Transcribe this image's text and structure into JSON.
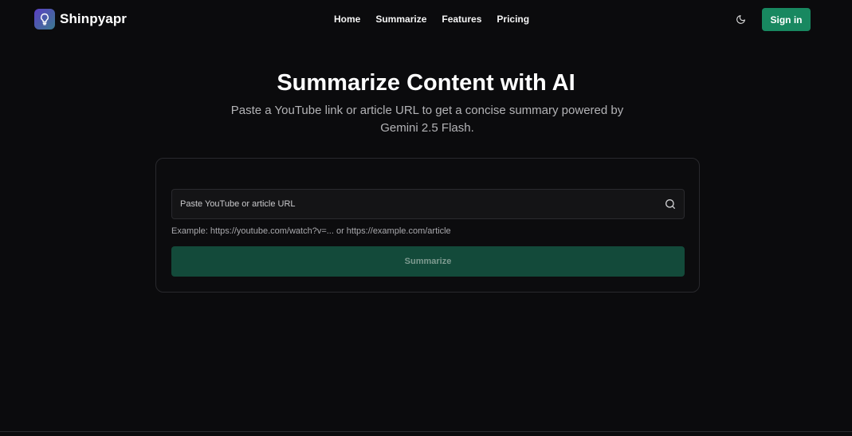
{
  "header": {
    "brand_name": "Shinpyapr",
    "nav": [
      "Home",
      "Summarize",
      "Features",
      "Pricing"
    ],
    "signin_label": "Sign in"
  },
  "hero": {
    "title": "Summarize Content with AI",
    "subtitle": "Paste a YouTube link or article URL to get a concise summary powered by Gemini 2.5 Flash."
  },
  "form": {
    "url_placeholder": "Paste YouTube or article URL",
    "url_value": "",
    "hint": "Example: https://youtube.com/watch?v=... or https://example.com/article",
    "submit_label": "Summarize"
  },
  "colors": {
    "accent": "#188860",
    "button_disabled": "#134a3a",
    "background": "#0b0b0d"
  },
  "icons": {
    "brand": "lightbulb-icon",
    "theme": "moon-icon",
    "search": "search-icon"
  }
}
